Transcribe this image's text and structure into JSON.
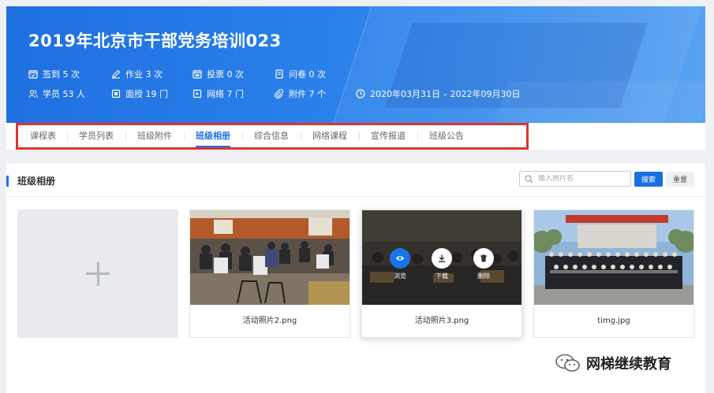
{
  "banner": {
    "title": "2019年北京市干部党务培训023",
    "stats_row1": [
      {
        "icon": "calendar-check-icon",
        "label": "签到 5 次"
      },
      {
        "icon": "pen-icon",
        "label": "作业 3 次"
      },
      {
        "icon": "calendar-icon",
        "label": "投票 0 次"
      },
      {
        "icon": "survey-icon",
        "label": "问卷 0 次"
      }
    ],
    "stats_row2": [
      {
        "icon": "users-icon",
        "label": "学员 53 人"
      },
      {
        "icon": "book-icon",
        "label": "面授 19 门"
      },
      {
        "icon": "screen-icon",
        "label": "网络 7 门"
      },
      {
        "icon": "paperclip-icon",
        "label": "附件 7 个"
      },
      {
        "icon": "clock-icon",
        "label": "2020年03月31日 – 2022年09月30日"
      }
    ]
  },
  "tabs": [
    {
      "label": "课程表"
    },
    {
      "label": "学员列表"
    },
    {
      "label": "班级附件"
    },
    {
      "label": "班级相册",
      "active": true
    },
    {
      "label": "综合信息"
    },
    {
      "label": "网络课程"
    },
    {
      "label": "宣传报道"
    },
    {
      "label": "班级公告"
    }
  ],
  "album": {
    "section_title": "班级相册",
    "search_placeholder": "输入照片名",
    "search_button": "搜索",
    "reset_button": "重置",
    "photos": [
      {
        "name": "活动照片2.png"
      },
      {
        "name": "活动照片3.png",
        "actions": [
          "浏览",
          "下载",
          "删除"
        ]
      },
      {
        "name": "timg.jpg"
      }
    ]
  },
  "watermark": {
    "text": "网梯继续教育"
  },
  "colors": {
    "accent": "#1a73e8",
    "highlight": "#e0322f",
    "preview_btn": "#1a73e8"
  }
}
